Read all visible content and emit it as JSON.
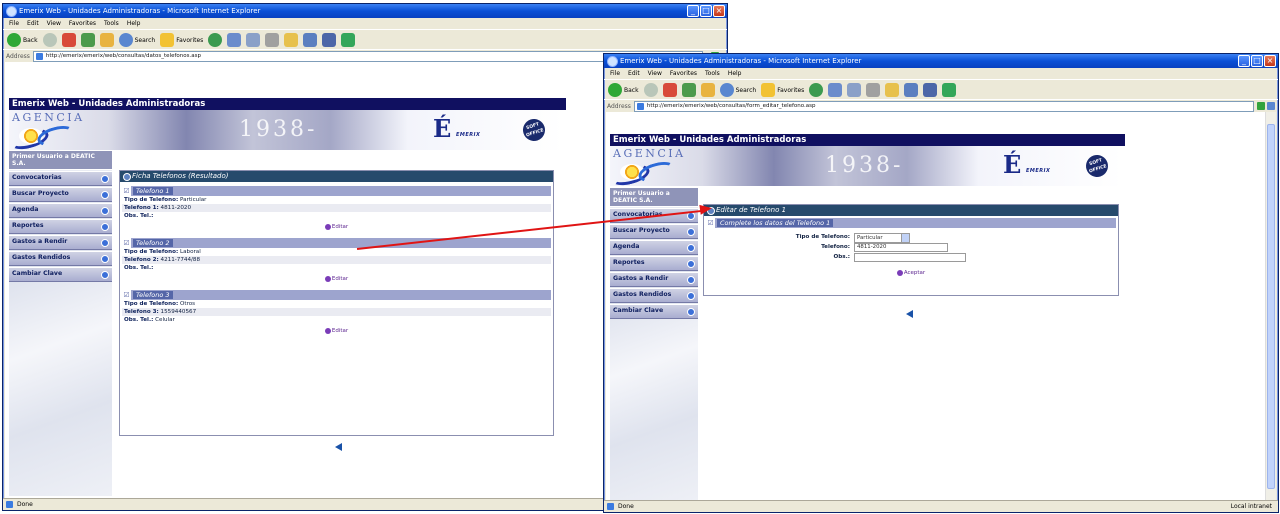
{
  "left_window": {
    "title": "Emerix Web - Unidades Administradoras - Microsoft Internet Explorer",
    "menu": [
      "File",
      "Edit",
      "View",
      "Favorites",
      "Tools",
      "Help"
    ],
    "toolbar": {
      "back": "Back",
      "search": "Search",
      "favorites": "Favorites"
    },
    "address_label": "Address",
    "address": "http://emerix/emerix/web/consultas/datos_telefonos.asp",
    "site_title": "Emerix Web - Unidades Administradoras",
    "agencia_text": "AGENCIA",
    "year_text": "1938-",
    "emerix_label": "EMERIX",
    "soft_badge": "SOFT OFFICE",
    "sidebar_head": "Primer Usuario a DEATIC S.A.",
    "sidebar_items": [
      "Convocatorias",
      "Buscar Proyecto",
      "Agenda",
      "Reportes",
      "Gastos a Rendir",
      "Gastos Rendidos",
      "Cambiar Clave"
    ],
    "panel_title": "Ficha Telefonos (Resultado)",
    "phones": [
      {
        "section": "Telefono 1",
        "type_label": "Tipo de Telefono:",
        "type_value": "Particular",
        "num_label": "Telefono 1:",
        "num_value": "4811-2020",
        "obs_label": "Obs. Tel.:",
        "obs_value": "",
        "edit": "Editar"
      },
      {
        "section": "Telefono 2",
        "type_label": "Tipo de Telefono:",
        "type_value": "Laboral",
        "num_label": "Telefono 2:",
        "num_value": "4211-7744/88",
        "obs_label": "Obs. Tel.:",
        "obs_value": "",
        "edit": "Editar"
      },
      {
        "section": "Telefono 3",
        "type_label": "Tipo de Telefono:",
        "type_value": "Otros",
        "num_label": "Telefono 3:",
        "num_value": "1559440567",
        "obs_label": "Obs. Tel.:",
        "obs_value": "Celular",
        "edit": "Editar"
      }
    ],
    "status": "Done"
  },
  "right_window": {
    "title": "Emerix Web - Unidades Administradoras - Microsoft Internet Explorer",
    "menu": [
      "File",
      "Edit",
      "View",
      "Favorites",
      "Tools",
      "Help"
    ],
    "toolbar": {
      "back": "Back",
      "search": "Search",
      "favorites": "Favorites"
    },
    "address_label": "Address",
    "address": "http://emerix/emerix/web/consultas/form_editar_telefono.asp",
    "site_title": "Emerix Web - Unidades Administradoras",
    "agencia_text": "AGENCIA",
    "year_text": "1938-",
    "emerix_label": "EMERIX",
    "soft_badge": "SOFT OFFICE",
    "sidebar_head": "Primer Usuario a DEATIC S.A.",
    "sidebar_items": [
      "Convocatorias",
      "Buscar Proyecto",
      "Agenda",
      "Reportes",
      "Gastos a Rendir",
      "Gastos Rendidos",
      "Cambiar Clave"
    ],
    "panel_title": "Editar de Telefono 1",
    "section": "Complete los datos del Telefono 1",
    "form": {
      "type_label": "Tipo de Telefono:",
      "type_value": "Particular",
      "phone_label": "Telefono:",
      "phone_value": "4811-2020",
      "obs_label": "Obs.:",
      "obs_value": "",
      "save": "Aceptar"
    },
    "status": "Done",
    "status_right": "Local intranet"
  },
  "colors": {
    "arrow": "#e01414",
    "banner": "#101060",
    "panel_head": "#264a6c",
    "section": "#9da4ce"
  }
}
